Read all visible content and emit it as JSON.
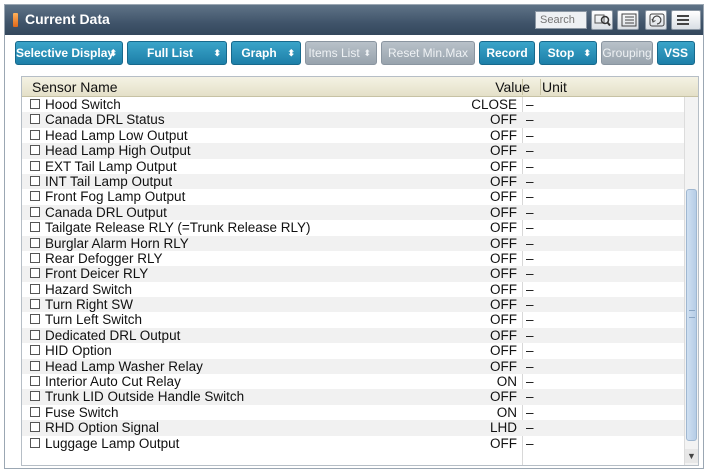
{
  "window": {
    "title": "Current Data"
  },
  "search": {
    "placeholder": "Search"
  },
  "toolbar": {
    "buttons": [
      {
        "label": "Selective Display",
        "has_arrow": true,
        "enabled": true
      },
      {
        "label": "Full List",
        "has_arrow": true,
        "enabled": true
      },
      {
        "label": "Graph",
        "has_arrow": true,
        "enabled": true
      },
      {
        "label": "Items List",
        "has_arrow": true,
        "enabled": false
      },
      {
        "label": "Reset Min.Max",
        "has_arrow": false,
        "enabled": false
      },
      {
        "label": "Record",
        "has_arrow": false,
        "enabled": true
      },
      {
        "label": "Stop",
        "has_arrow": true,
        "enabled": true
      },
      {
        "label": "Grouping",
        "has_arrow": false,
        "enabled": false
      },
      {
        "label": "VSS",
        "has_arrow": false,
        "enabled": true
      }
    ],
    "arrow_glyph": "⬍"
  },
  "table": {
    "columns": {
      "name": "Sensor Name",
      "value": "Value",
      "unit": "Unit"
    },
    "rows": [
      {
        "name": "Hood Switch",
        "value": "CLOSE",
        "unit": "–"
      },
      {
        "name": "Canada DRL Status",
        "value": "OFF",
        "unit": "–"
      },
      {
        "name": "Head Lamp Low Output",
        "value": "OFF",
        "unit": "–"
      },
      {
        "name": "Head Lamp High Output",
        "value": "OFF",
        "unit": "–"
      },
      {
        "name": "EXT Tail Lamp Output",
        "value": "OFF",
        "unit": "–"
      },
      {
        "name": "INT Tail Lamp Output",
        "value": "OFF",
        "unit": "–"
      },
      {
        "name": "Front Fog Lamp Output",
        "value": "OFF",
        "unit": "–"
      },
      {
        "name": "Canada DRL Output",
        "value": "OFF",
        "unit": "–"
      },
      {
        "name": "Tailgate Release RLY (=Trunk Release RLY)",
        "value": "OFF",
        "unit": "–"
      },
      {
        "name": "Burglar Alarm Horn RLY",
        "value": "OFF",
        "unit": "–"
      },
      {
        "name": "Rear Defogger RLY",
        "value": "OFF",
        "unit": "–"
      },
      {
        "name": "Front Deicer RLY",
        "value": "OFF",
        "unit": "–"
      },
      {
        "name": "Hazard Switch",
        "value": "OFF",
        "unit": "–"
      },
      {
        "name": "Turn Right SW",
        "value": "OFF",
        "unit": "–"
      },
      {
        "name": "Turn Left Switch",
        "value": "OFF",
        "unit": "–"
      },
      {
        "name": "Dedicated DRL Output",
        "value": "OFF",
        "unit": "–"
      },
      {
        "name": "HID Option",
        "value": "OFF",
        "unit": "–"
      },
      {
        "name": "Head Lamp Washer Relay",
        "value": "OFF",
        "unit": "–"
      },
      {
        "name": "Interior Auto Cut Relay",
        "value": "ON",
        "unit": "–"
      },
      {
        "name": "Trunk LID Outside Handle Switch",
        "value": "OFF",
        "unit": "–"
      },
      {
        "name": "Fuse Switch",
        "value": "ON",
        "unit": "–"
      },
      {
        "name": "RHD Option Signal",
        "value": "LHD",
        "unit": "–"
      },
      {
        "name": "Luggage Lamp Output",
        "value": "OFF",
        "unit": "–"
      }
    ]
  },
  "icons": {
    "title": "title-accent-icon",
    "search": "search-icon",
    "list": "list-icon",
    "retry": "retry-icon",
    "menu": "menu-icon",
    "scroll_down": "chevron-down-icon"
  },
  "colors": {
    "title_bar": "#40546a",
    "button": "#2a8fba",
    "accent": "#e0671a"
  }
}
